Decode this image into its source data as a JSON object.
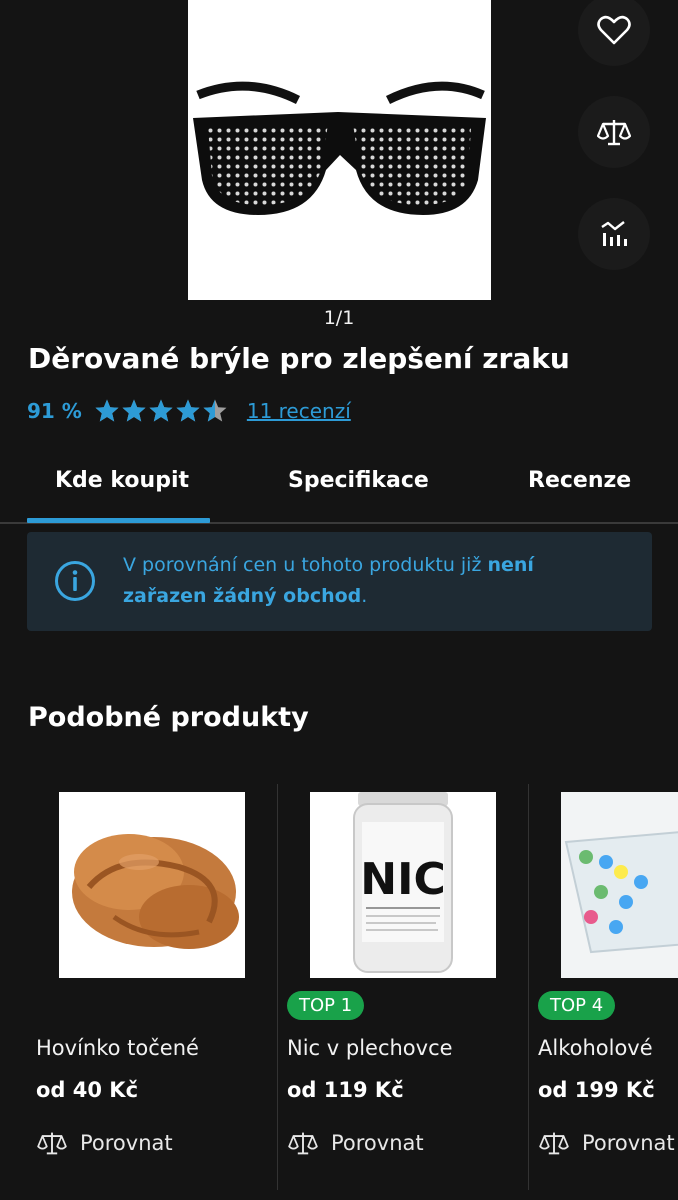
{
  "gallery": {
    "counter": "1/1"
  },
  "side_actions": {
    "favorite_icon": "heart-icon",
    "compare_icon": "scales-icon",
    "price_history_icon": "chart-icon"
  },
  "product": {
    "title": "Děrované brýle pro zlepšení zraku",
    "rating_percent": "91 %",
    "stars": 4.5,
    "reviews_link": "11 recenzí"
  },
  "tabs": [
    {
      "label": "Kde koupit",
      "active": true
    },
    {
      "label": "Specifikace",
      "active": false
    },
    {
      "label": "Recenze",
      "active": false
    }
  ],
  "info_box": {
    "text_before": "V porovnání cen u tohoto produktu již ",
    "text_bold": "není zařazen žádný obchod",
    "text_after": ".",
    "color": "#3aa6e0"
  },
  "similar": {
    "title": "Podobné produkty",
    "items": [
      {
        "badge": "",
        "name": "Hovínko točené",
        "price": "od 40 Kč",
        "compare_label": "Porovnat"
      },
      {
        "badge": "TOP 1",
        "name": "Nic v plechovce",
        "price": "od 119 Kč",
        "compare_label": "Porovnat",
        "image_text": "NIC"
      },
      {
        "badge": "TOP 4",
        "name": "Alkoholové",
        "price": "od 199 Kč",
        "compare_label": "Porovnat"
      }
    ]
  },
  "colors": {
    "background": "#141414",
    "accent": "#2d9bd6",
    "badge": "#19a24a"
  }
}
